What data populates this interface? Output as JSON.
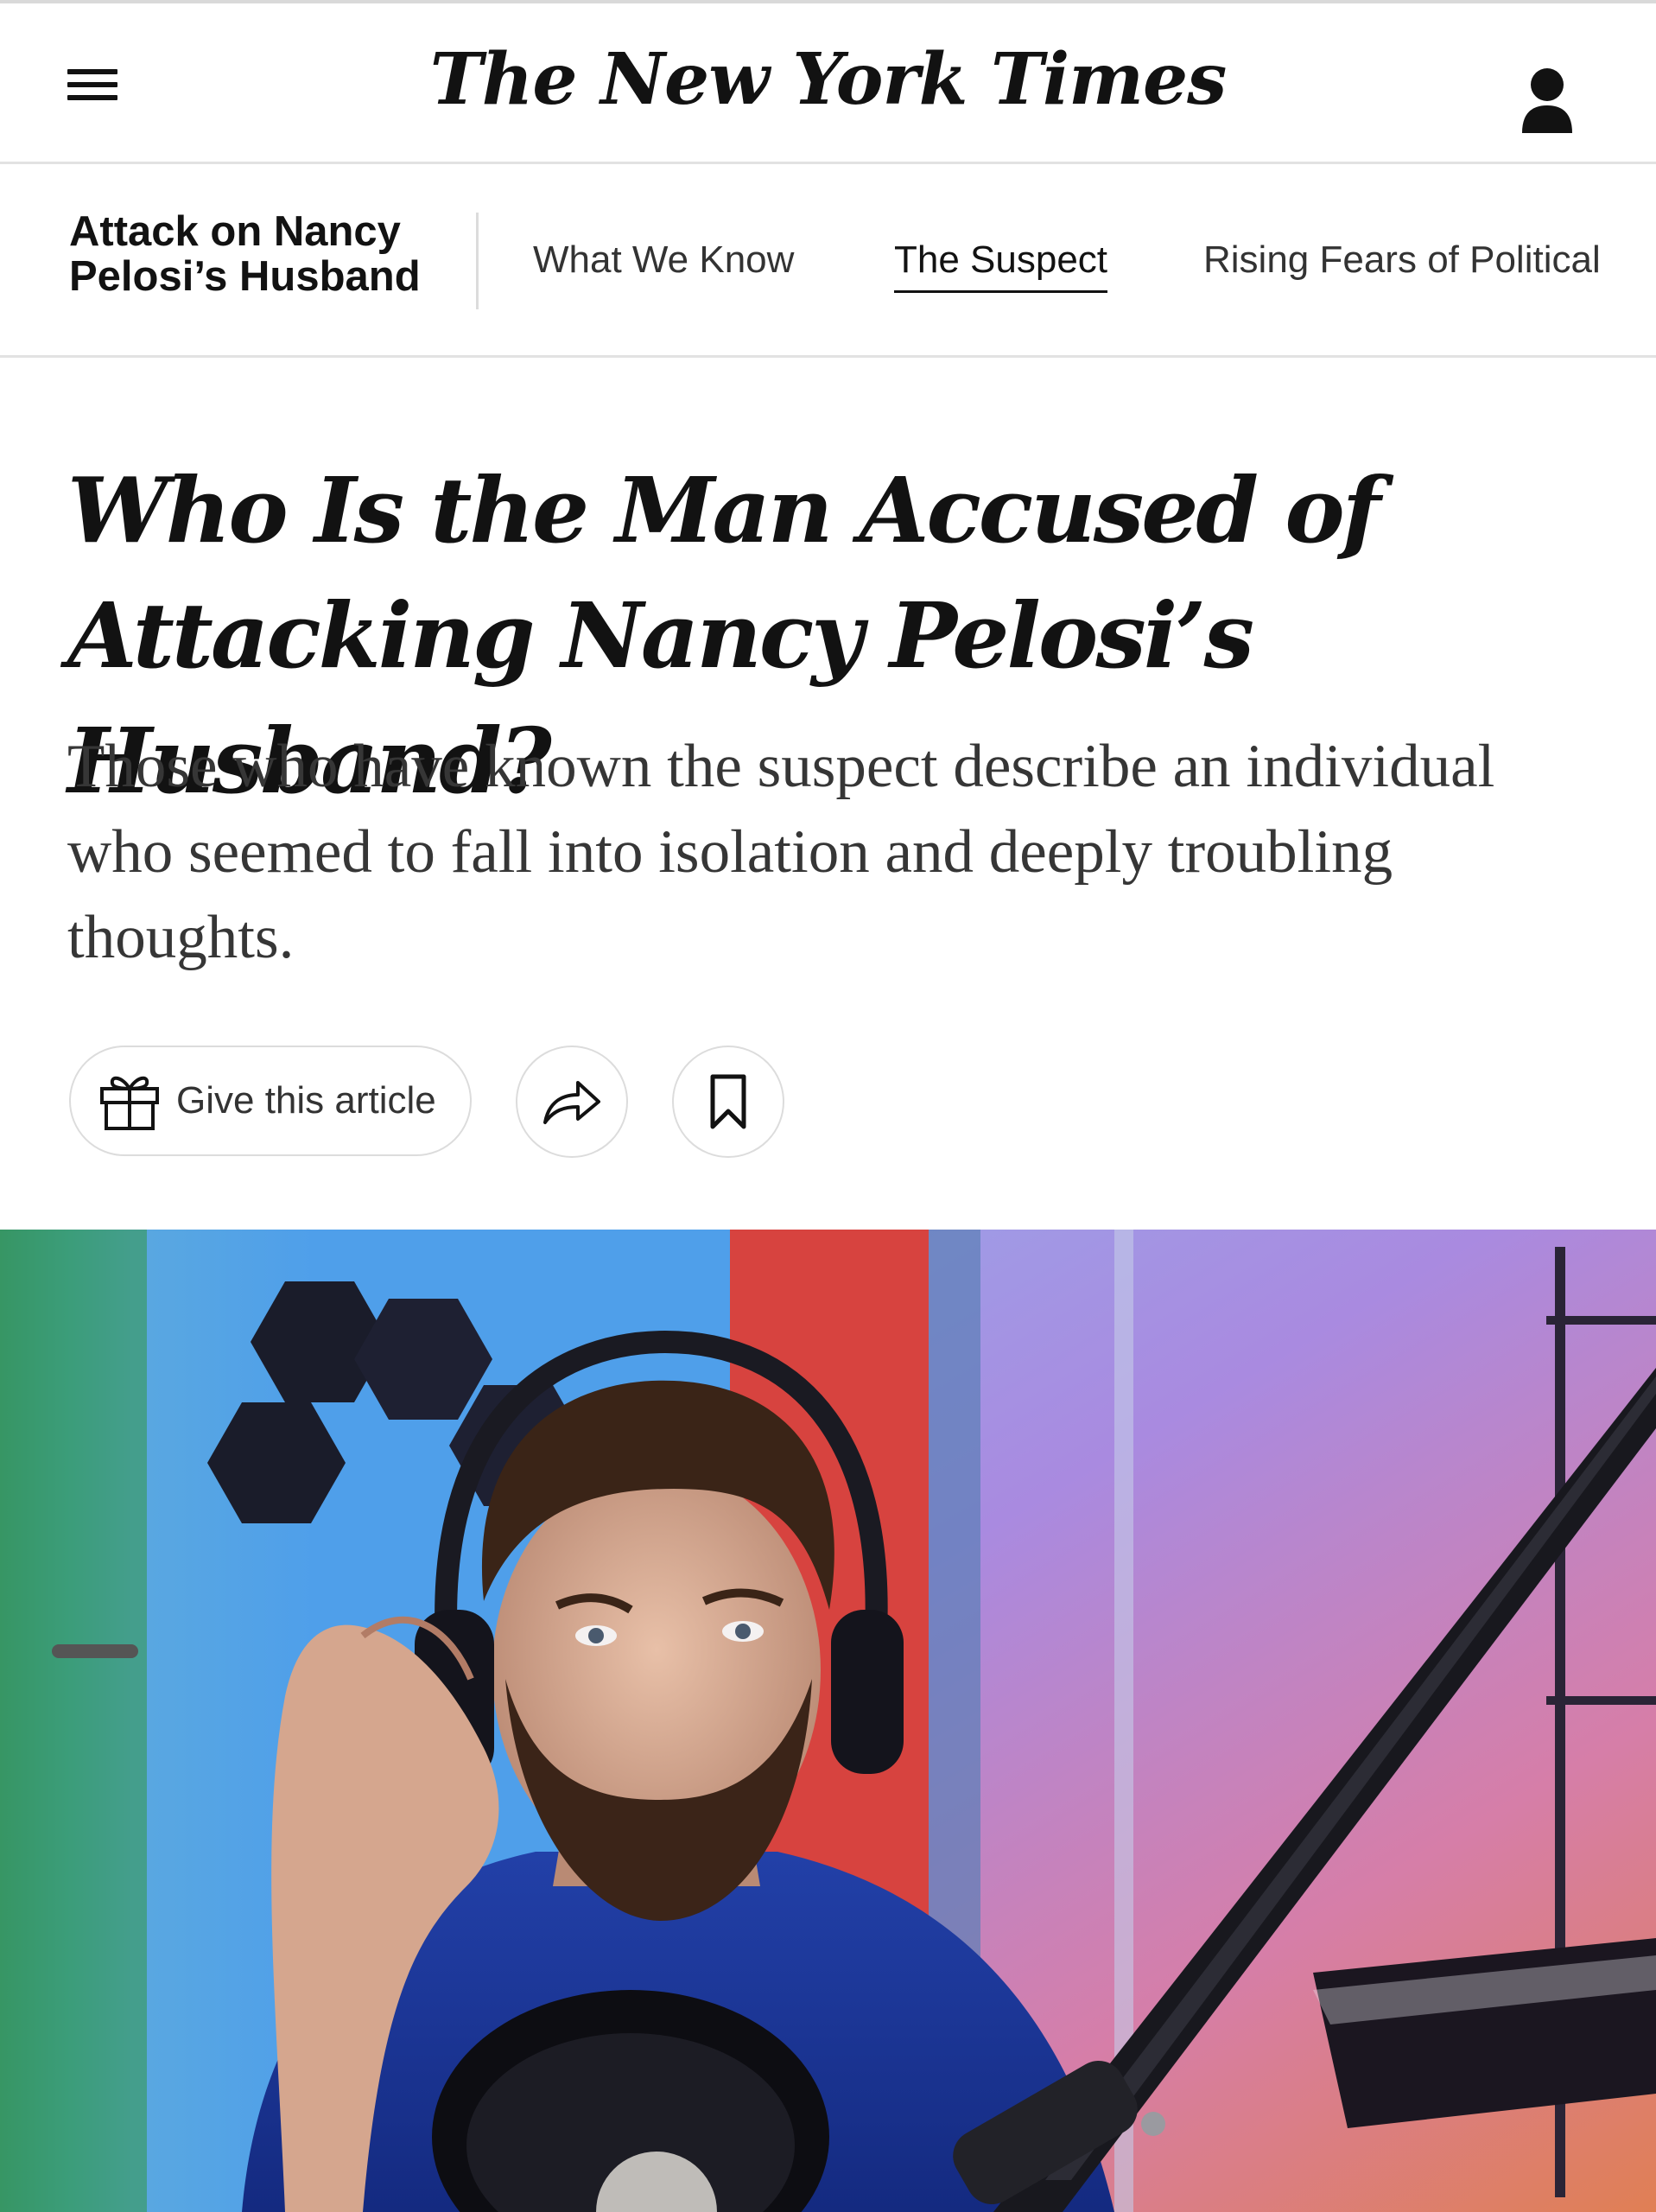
{
  "masthead": {
    "logo": "The New York Times",
    "menu_icon": "hamburger-menu-icon",
    "account_icon": "account-icon"
  },
  "section_nav": {
    "title": "Attack on Nancy Pelosi’s Husband",
    "links": [
      {
        "label": "What We Know",
        "active": false
      },
      {
        "label": "The Suspect",
        "active": true
      },
      {
        "label": "Rising Fears of Political",
        "active": false
      }
    ]
  },
  "article": {
    "headline": "Who Is the Man Accused of Attacking Nancy Pelosi’s Husband?",
    "summary": "Those who have known the suspect describe an individual who seemed to fall into isolation and deeply troubling thoughts.",
    "actions": {
      "gift_label": "Give this article",
      "gift_icon": "gift-icon",
      "share_icon": "share-arrow-icon",
      "save_icon": "bookmark-icon"
    }
  },
  "colors": {
    "text": "#121212",
    "subtext": "#363636",
    "divider": "#e2e2e2"
  }
}
